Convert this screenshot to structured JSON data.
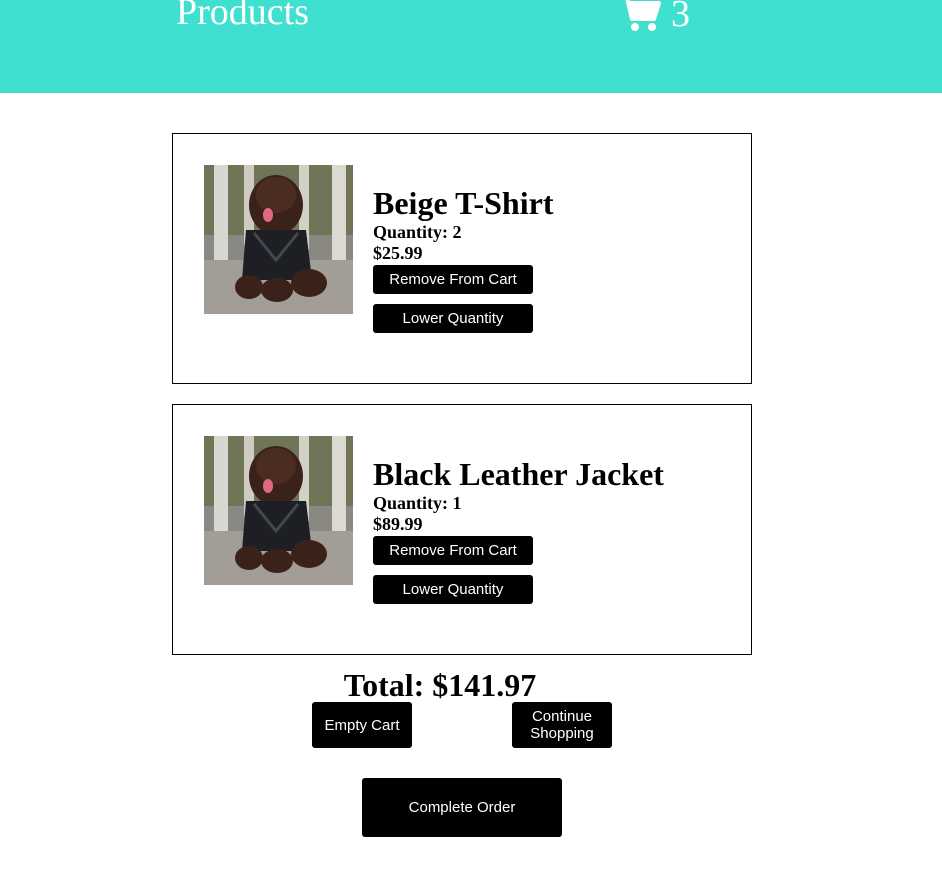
{
  "header": {
    "title": "Products",
    "cart_icon": "shopping-cart-icon",
    "cart_count": "3",
    "background_color": "#40e0d0"
  },
  "cart": {
    "items": [
      {
        "name": "Beige T-Shirt",
        "quantity": "Quantity: 2",
        "price": "$25.99",
        "remove_label": "Remove From Cart",
        "lower_label": "Lower Quantity"
      },
      {
        "name": "Black Leather Jacket",
        "quantity": "Quantity: 1",
        "price": "$89.99",
        "remove_label": "Remove From Cart",
        "lower_label": "Lower Quantity"
      }
    ],
    "total": "Total: $141.97",
    "empty_label": "Empty Cart",
    "continue_label": "Continue Shopping",
    "complete_label": "Complete Order"
  }
}
